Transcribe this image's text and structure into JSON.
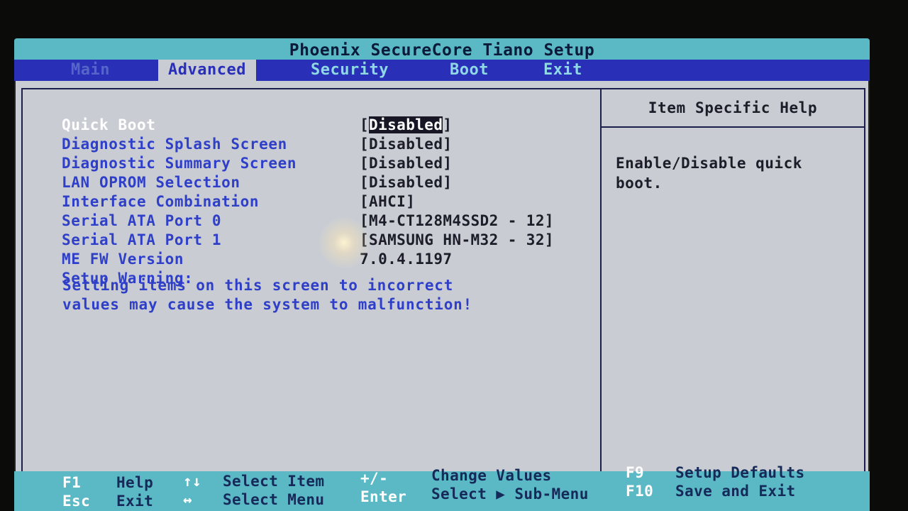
{
  "window": {
    "title": "Phoenix SecureCore Tiano Setup"
  },
  "menu": [
    {
      "label": "Main"
    },
    {
      "label": "Advanced"
    },
    {
      "label": "Security"
    },
    {
      "label": "Boot"
    },
    {
      "label": "Exit"
    }
  ],
  "settings": [
    {
      "label": "Quick Boot",
      "value": "Disabled",
      "selected": true
    },
    {
      "label": "Diagnostic Splash Screen",
      "value": "[Disabled]"
    },
    {
      "label": "Diagnostic Summary Screen",
      "value": "[Disabled]"
    },
    {
      "label": "LAN OPROM Selection",
      "value": "[Disabled]"
    },
    {
      "label": "Interface Combination",
      "value": "[AHCI]"
    },
    {
      "label": "Serial ATA Port 0",
      "value": "[M4-CT128M4SSD2 - 12]"
    },
    {
      "label": "Serial ATA Port 1",
      "value": "[SAMSUNG HN-M32 - 32]"
    },
    {
      "label": "ME FW Version",
      "value": "7.0.4.1197"
    },
    {
      "label": "Setup Warning:",
      "value": ""
    }
  ],
  "warning": {
    "line1": "Setting items on this screen to incorrect",
    "line2": "values may cause the system to malfunction!"
  },
  "help": {
    "title": "Item Specific Help",
    "text": "Enable/Disable quick boot."
  },
  "footer": {
    "f1_key": "F1",
    "f1_desc": "Help",
    "esc_key": "Esc",
    "esc_desc": "Exit",
    "updown_key": "↑↓",
    "updown_desc": "Select Item",
    "leftright_key": "↔",
    "leftright_desc": "Select Menu",
    "plusminus_key": "+/-",
    "plusminus_desc": "Change Values",
    "enter_key": "Enter",
    "enter_desc": "Select ▶ Sub-Menu",
    "f9_key": "F9",
    "f9_desc": "Setup Defaults",
    "f10_key": "F10",
    "f10_desc": "Save and Exit"
  },
  "colors": {
    "menubar": "#2a2fb8",
    "titlebar": "#5ab9c4",
    "panel_bg": "#c9cdd3",
    "label_blue": "#2f3fc8"
  }
}
